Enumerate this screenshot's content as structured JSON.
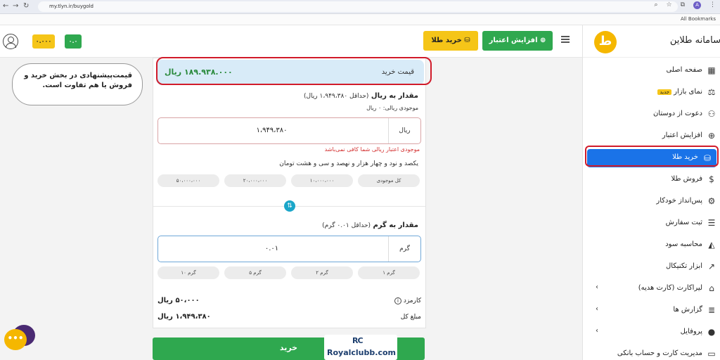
{
  "browser": {
    "url": "my.tlyn.ir/buygold",
    "bookmarks_label": "All Bookmarks",
    "profile_initial": "A"
  },
  "header": {
    "balance_gold": "۰.۰۰۰",
    "balance_rial": "۰.۰",
    "buy_gold_label": "خرید طلا",
    "increase_credit_label": "افزایش اعتبار"
  },
  "sidebar": {
    "brand": "سامانه طلاین",
    "logo_letter": "ط",
    "items": [
      {
        "label": "صفحه اصلی",
        "icon": "grid-icon",
        "glyph": "▦"
      },
      {
        "label": "نمای بازار",
        "badge": "جدید",
        "icon": "market-icon",
        "glyph": "⚖"
      },
      {
        "label": "دعوت از دوستان",
        "icon": "users-icon",
        "glyph": "⚇"
      },
      {
        "label": "افزایش اعتبار",
        "icon": "plus-circle-icon",
        "glyph": "⊕"
      },
      {
        "label": "خرید طلا",
        "icon": "gold-bars-icon",
        "glyph": "⛁",
        "active": true
      },
      {
        "label": "فروش طلا",
        "icon": "money-bag-icon",
        "glyph": "$"
      },
      {
        "label": "پس‌انداز خودکار",
        "icon": "robot-icon",
        "glyph": "⚙"
      },
      {
        "label": "ثبت سفارش",
        "icon": "order-icon",
        "glyph": "☰"
      },
      {
        "label": "محاسبه سود",
        "icon": "chart-area-icon",
        "glyph": "◭"
      },
      {
        "label": "ابزار تکنیکال",
        "icon": "chart-line-icon",
        "glyph": "↗"
      },
      {
        "label": "لیراکارت (کارت هدیه)",
        "icon": "gift-icon",
        "glyph": "⌂",
        "chevron": "‹"
      },
      {
        "label": "گزارش ها",
        "icon": "report-icon",
        "glyph": "≣",
        "chevron": "‹"
      },
      {
        "label": "پروفایل",
        "icon": "user-icon",
        "glyph": "●",
        "chevron": "‹"
      },
      {
        "label": "مدیریت کارت و حساب بانکی",
        "icon": "card-icon",
        "glyph": "▭"
      }
    ]
  },
  "callout": {
    "text": "قیمت‌پیشنهادی در بخش خرید و فروش یا هم تفاوت است."
  },
  "buy_form": {
    "price_label": "قیمت خرید",
    "price_value": "۱۸۹.۹۳۸.۰۰۰ ریال",
    "rial_title": "مقدار به ریال",
    "rial_min": "(حداقل ۱،۹۴۹،۳۸۰ ریال)",
    "rial_balance": "موجودی ریالی: ۰ ریال",
    "rial_value": "۱،۹۴۹،۳۸۰",
    "rial_unit": "ریال",
    "error": "موجودی اعتبار ریالی شما کافی نمی‌باشد",
    "amount_words": "یکصد و نود و چهار هزار و نهصد و سی و هشت تومان",
    "rial_chips": [
      "کل موجودی",
      "۱۰،۰۰۰،۰۰۰",
      "۲۰،۰۰۰،۰۰۰",
      "۵۰،۰۰۰،۰۰۰"
    ],
    "gram_title": "مقدار به گرم",
    "gram_min": "(حداقل ۰.۰۱ گرم)",
    "gram_value": "۰.۰۱",
    "gram_unit": "گرم",
    "gram_chips": [
      "۱ گرم",
      "۲ گرم",
      "۵ گرم",
      "۱۰ گرم"
    ],
    "fee_label": "کارمزد",
    "fee_value": "۵۰،۰۰۰ ریال",
    "total_label": "مبلغ کل",
    "total_value": "۱،۹۴۹،۳۸۰ ریال",
    "submit_label": "خرید"
  },
  "watermark": {
    "mark": "RC",
    "text": "Royalclubb.com"
  },
  "colors": {
    "accent_green": "#2fa84f",
    "accent_gold": "#f5c518",
    "active_blue": "#1a73e8",
    "highlight_red": "#d11b2a"
  }
}
